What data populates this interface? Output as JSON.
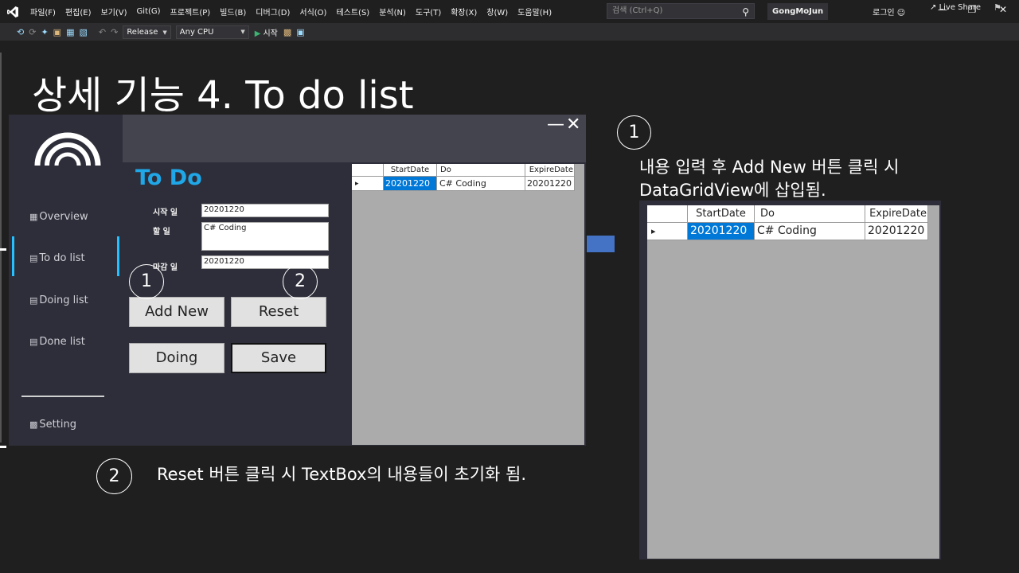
{
  "menubar": {
    "items": [
      "파일(F)",
      "편집(E)",
      "보기(V)",
      "Git(G)",
      "프로젝트(P)",
      "빌드(B)",
      "디버그(D)",
      "서식(O)",
      "테스트(S)",
      "분석(N)",
      "도구(T)",
      "확장(X)",
      "창(W)",
      "도움말(H)"
    ],
    "search_placeholder": "검색 (Ctrl+Q)",
    "solution_name": "GongMoJun",
    "login": "로그인"
  },
  "toolbar": {
    "configuration": "Release",
    "platform": "Any CPU",
    "start": "시작",
    "live_share": "Live Share"
  },
  "slide": {
    "title": "상세 기능 4. To do list",
    "note1_number": "1",
    "note1_line1": "내용 입력 후  Add New 버튼 클릭 시",
    "note1_line2": "DataGridView에 삽입됨.",
    "note2_number": "2",
    "note2_text": "Reset 버튼 클릭 시 TextBox의 내용들이 초기화 됨."
  },
  "app": {
    "minimize_glyph": "—",
    "close_glyph": "✕",
    "nav": [
      "Overview",
      "To do list",
      "Doing list",
      "Done list",
      "Setting"
    ],
    "heading": "To Do",
    "labels": {
      "start": "시작 일",
      "todo": "할 일",
      "due": "마감 일"
    },
    "values": {
      "start": "20201220",
      "todo": "C# Coding",
      "due": "20201220"
    },
    "buttons": {
      "add_new": "Add New",
      "reset": "Reset",
      "doing": "Doing",
      "save": "Save"
    },
    "badge1": "1",
    "badge2": "2",
    "grid": {
      "columns": [
        "StartDate",
        "Do",
        "ExpireDate"
      ],
      "row_marker": "▸",
      "rows": [
        [
          "20201220",
          "C# Coding",
          "20201220"
        ]
      ]
    }
  }
}
